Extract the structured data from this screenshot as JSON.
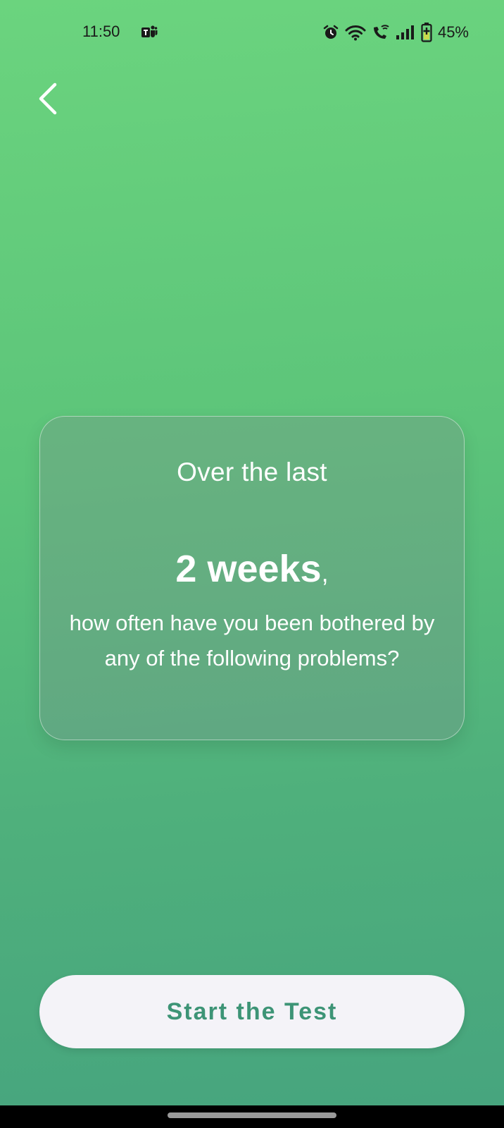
{
  "status_bar": {
    "time": "11:50",
    "battery_percent": "45%",
    "icons": [
      "teams-icon",
      "alarm-icon",
      "wifi-icon",
      "wifi-calling-icon",
      "signal-icon",
      "battery-charging-icon"
    ]
  },
  "header": {
    "back_icon": "chevron-left-icon"
  },
  "card": {
    "intro": "Over the last",
    "highlight": "2 weeks",
    "highlight_suffix": ",",
    "question": "how often have you been bothered by any of the following problems?"
  },
  "actions": {
    "start_label": "Start the Test"
  },
  "colors": {
    "gradient_top": "#6bd47e",
    "gradient_bottom": "#46a47e",
    "button_bg": "#f4f3f8",
    "button_text": "#3d9476"
  }
}
